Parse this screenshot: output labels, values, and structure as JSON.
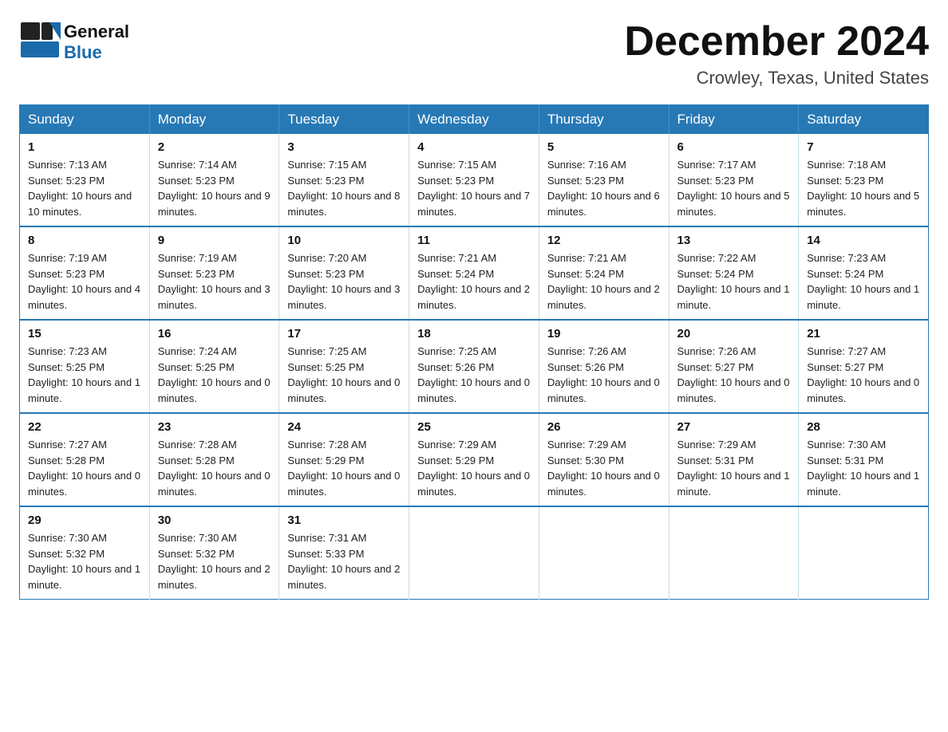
{
  "header": {
    "logo_line1": "General",
    "logo_line2": "Blue",
    "month_title": "December 2024",
    "location": "Crowley, Texas, United States"
  },
  "days_of_week": [
    "Sunday",
    "Monday",
    "Tuesday",
    "Wednesday",
    "Thursday",
    "Friday",
    "Saturday"
  ],
  "weeks": [
    [
      {
        "day": "1",
        "sunrise": "7:13 AM",
        "sunset": "5:23 PM",
        "daylight": "10 hours and 10 minutes."
      },
      {
        "day": "2",
        "sunrise": "7:14 AM",
        "sunset": "5:23 PM",
        "daylight": "10 hours and 9 minutes."
      },
      {
        "day": "3",
        "sunrise": "7:15 AM",
        "sunset": "5:23 PM",
        "daylight": "10 hours and 8 minutes."
      },
      {
        "day": "4",
        "sunrise": "7:15 AM",
        "sunset": "5:23 PM",
        "daylight": "10 hours and 7 minutes."
      },
      {
        "day": "5",
        "sunrise": "7:16 AM",
        "sunset": "5:23 PM",
        "daylight": "10 hours and 6 minutes."
      },
      {
        "day": "6",
        "sunrise": "7:17 AM",
        "sunset": "5:23 PM",
        "daylight": "10 hours and 5 minutes."
      },
      {
        "day": "7",
        "sunrise": "7:18 AM",
        "sunset": "5:23 PM",
        "daylight": "10 hours and 5 minutes."
      }
    ],
    [
      {
        "day": "8",
        "sunrise": "7:19 AM",
        "sunset": "5:23 PM",
        "daylight": "10 hours and 4 minutes."
      },
      {
        "day": "9",
        "sunrise": "7:19 AM",
        "sunset": "5:23 PM",
        "daylight": "10 hours and 3 minutes."
      },
      {
        "day": "10",
        "sunrise": "7:20 AM",
        "sunset": "5:23 PM",
        "daylight": "10 hours and 3 minutes."
      },
      {
        "day": "11",
        "sunrise": "7:21 AM",
        "sunset": "5:24 PM",
        "daylight": "10 hours and 2 minutes."
      },
      {
        "day": "12",
        "sunrise": "7:21 AM",
        "sunset": "5:24 PM",
        "daylight": "10 hours and 2 minutes."
      },
      {
        "day": "13",
        "sunrise": "7:22 AM",
        "sunset": "5:24 PM",
        "daylight": "10 hours and 1 minute."
      },
      {
        "day": "14",
        "sunrise": "7:23 AM",
        "sunset": "5:24 PM",
        "daylight": "10 hours and 1 minute."
      }
    ],
    [
      {
        "day": "15",
        "sunrise": "7:23 AM",
        "sunset": "5:25 PM",
        "daylight": "10 hours and 1 minute."
      },
      {
        "day": "16",
        "sunrise": "7:24 AM",
        "sunset": "5:25 PM",
        "daylight": "10 hours and 0 minutes."
      },
      {
        "day": "17",
        "sunrise": "7:25 AM",
        "sunset": "5:25 PM",
        "daylight": "10 hours and 0 minutes."
      },
      {
        "day": "18",
        "sunrise": "7:25 AM",
        "sunset": "5:26 PM",
        "daylight": "10 hours and 0 minutes."
      },
      {
        "day": "19",
        "sunrise": "7:26 AM",
        "sunset": "5:26 PM",
        "daylight": "10 hours and 0 minutes."
      },
      {
        "day": "20",
        "sunrise": "7:26 AM",
        "sunset": "5:27 PM",
        "daylight": "10 hours and 0 minutes."
      },
      {
        "day": "21",
        "sunrise": "7:27 AM",
        "sunset": "5:27 PM",
        "daylight": "10 hours and 0 minutes."
      }
    ],
    [
      {
        "day": "22",
        "sunrise": "7:27 AM",
        "sunset": "5:28 PM",
        "daylight": "10 hours and 0 minutes."
      },
      {
        "day": "23",
        "sunrise": "7:28 AM",
        "sunset": "5:28 PM",
        "daylight": "10 hours and 0 minutes."
      },
      {
        "day": "24",
        "sunrise": "7:28 AM",
        "sunset": "5:29 PM",
        "daylight": "10 hours and 0 minutes."
      },
      {
        "day": "25",
        "sunrise": "7:29 AM",
        "sunset": "5:29 PM",
        "daylight": "10 hours and 0 minutes."
      },
      {
        "day": "26",
        "sunrise": "7:29 AM",
        "sunset": "5:30 PM",
        "daylight": "10 hours and 0 minutes."
      },
      {
        "day": "27",
        "sunrise": "7:29 AM",
        "sunset": "5:31 PM",
        "daylight": "10 hours and 1 minute."
      },
      {
        "day": "28",
        "sunrise": "7:30 AM",
        "sunset": "5:31 PM",
        "daylight": "10 hours and 1 minute."
      }
    ],
    [
      {
        "day": "29",
        "sunrise": "7:30 AM",
        "sunset": "5:32 PM",
        "daylight": "10 hours and 1 minute."
      },
      {
        "day": "30",
        "sunrise": "7:30 AM",
        "sunset": "5:32 PM",
        "daylight": "10 hours and 2 minutes."
      },
      {
        "day": "31",
        "sunrise": "7:31 AM",
        "sunset": "5:33 PM",
        "daylight": "10 hours and 2 minutes."
      },
      null,
      null,
      null,
      null
    ]
  ]
}
